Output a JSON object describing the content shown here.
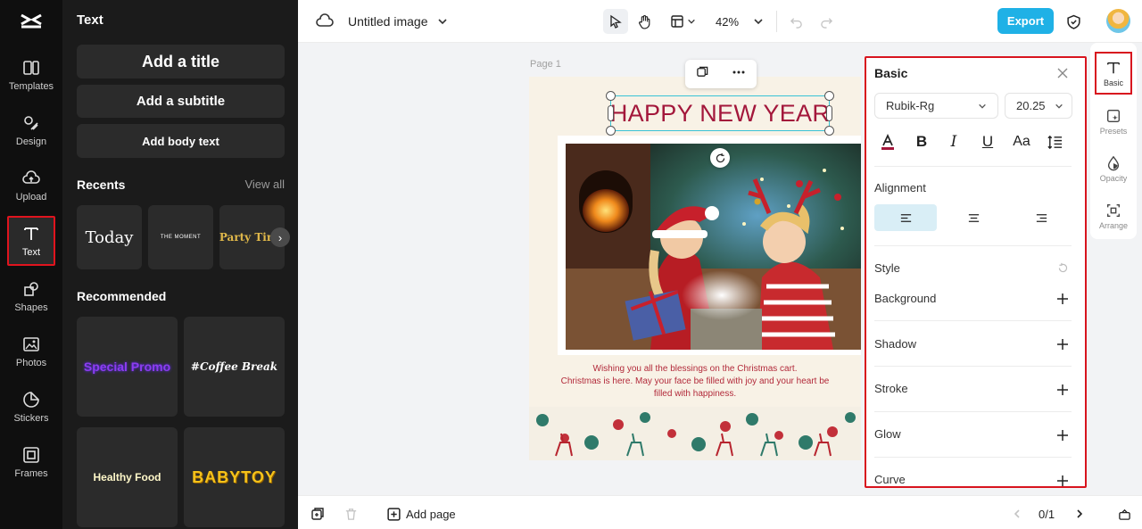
{
  "app": {
    "title": "Untitled image",
    "zoom": "42%",
    "export_label": "Export",
    "page_label": "Page 1"
  },
  "rail": {
    "items": [
      {
        "label": "Templates",
        "icon": "templates-icon"
      },
      {
        "label": "Design",
        "icon": "design-icon"
      },
      {
        "label": "Upload",
        "icon": "upload-icon"
      },
      {
        "label": "Text",
        "icon": "text-icon"
      },
      {
        "label": "Shapes",
        "icon": "shapes-icon"
      },
      {
        "label": "Photos",
        "icon": "photos-icon"
      },
      {
        "label": "Stickers",
        "icon": "stickers-icon"
      },
      {
        "label": "Frames",
        "icon": "frames-icon"
      }
    ]
  },
  "panel": {
    "title": "Text",
    "add_title": "Add a title",
    "add_subtitle": "Add a subtitle",
    "add_body": "Add body text",
    "recents_title": "Recents",
    "view_all": "View all",
    "recents": [
      "Today",
      "THE MOMENT",
      "Party Time"
    ],
    "recommended_title": "Recommended",
    "recommended": [
      "Special Promo",
      "#Coffee Break",
      "Healthy Food",
      "BABYTOY"
    ]
  },
  "canvas": {
    "headline": "HAPPY NEW YEAR",
    "wish_line1": "Wishing you all the blessings on the Christmas cart.",
    "wish_line2": "Christmas is here. May your face be filled with joy and your heart be",
    "wish_line3": "filled with happiness."
  },
  "props": {
    "title": "Basic",
    "font": "Rubik-Rg",
    "size": "20.25",
    "alignment_title": "Alignment",
    "style_title": "Style",
    "rows": [
      "Background",
      "Shadow",
      "Stroke",
      "Glow",
      "Curve"
    ]
  },
  "right_tabs": [
    "Basic",
    "Presets",
    "Opacity",
    "Arrange"
  ],
  "bottom": {
    "add_page": "Add page",
    "page_count": "0/1"
  },
  "colors": {
    "accent": "#1fb1e6",
    "highlight": "#d8141e",
    "headline": "#a3173b",
    "selection": "#38c3d6"
  }
}
